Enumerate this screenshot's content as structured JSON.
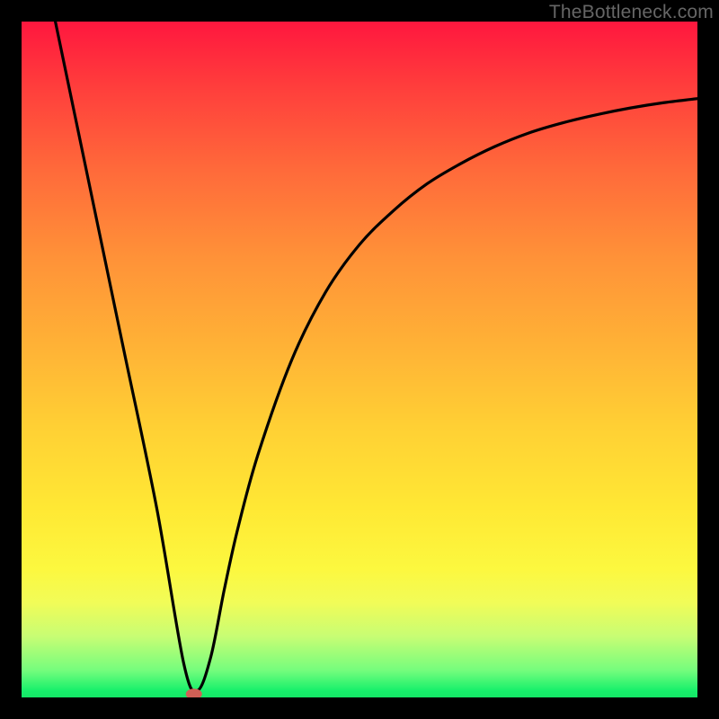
{
  "watermark": "TheBottleneck.com",
  "chart_data": {
    "type": "line",
    "title": "",
    "xlabel": "",
    "ylabel": "",
    "xlim": [
      0,
      100
    ],
    "ylim": [
      0,
      100
    ],
    "grid": false,
    "legend": false,
    "series": [
      {
        "name": "bottleneck-curve",
        "x": [
          5,
          10,
          15,
          20,
          24,
          26,
          28,
          30,
          32,
          35,
          40,
          45,
          50,
          55,
          60,
          65,
          70,
          75,
          80,
          85,
          90,
          95,
          100
        ],
        "y": [
          100,
          76,
          52,
          28,
          5,
          1,
          6,
          16,
          25,
          36,
          50,
          60,
          67,
          72,
          76,
          79,
          81.5,
          83.5,
          85,
          86.2,
          87.2,
          88,
          88.6
        ]
      }
    ],
    "marker": {
      "name": "optimal-point",
      "x": 25.5,
      "y": 0.5,
      "color": "#d06056"
    },
    "background_gradient": {
      "top": "#ff173e",
      "mid": "#ffd034",
      "bottom": "#14e666"
    }
  }
}
